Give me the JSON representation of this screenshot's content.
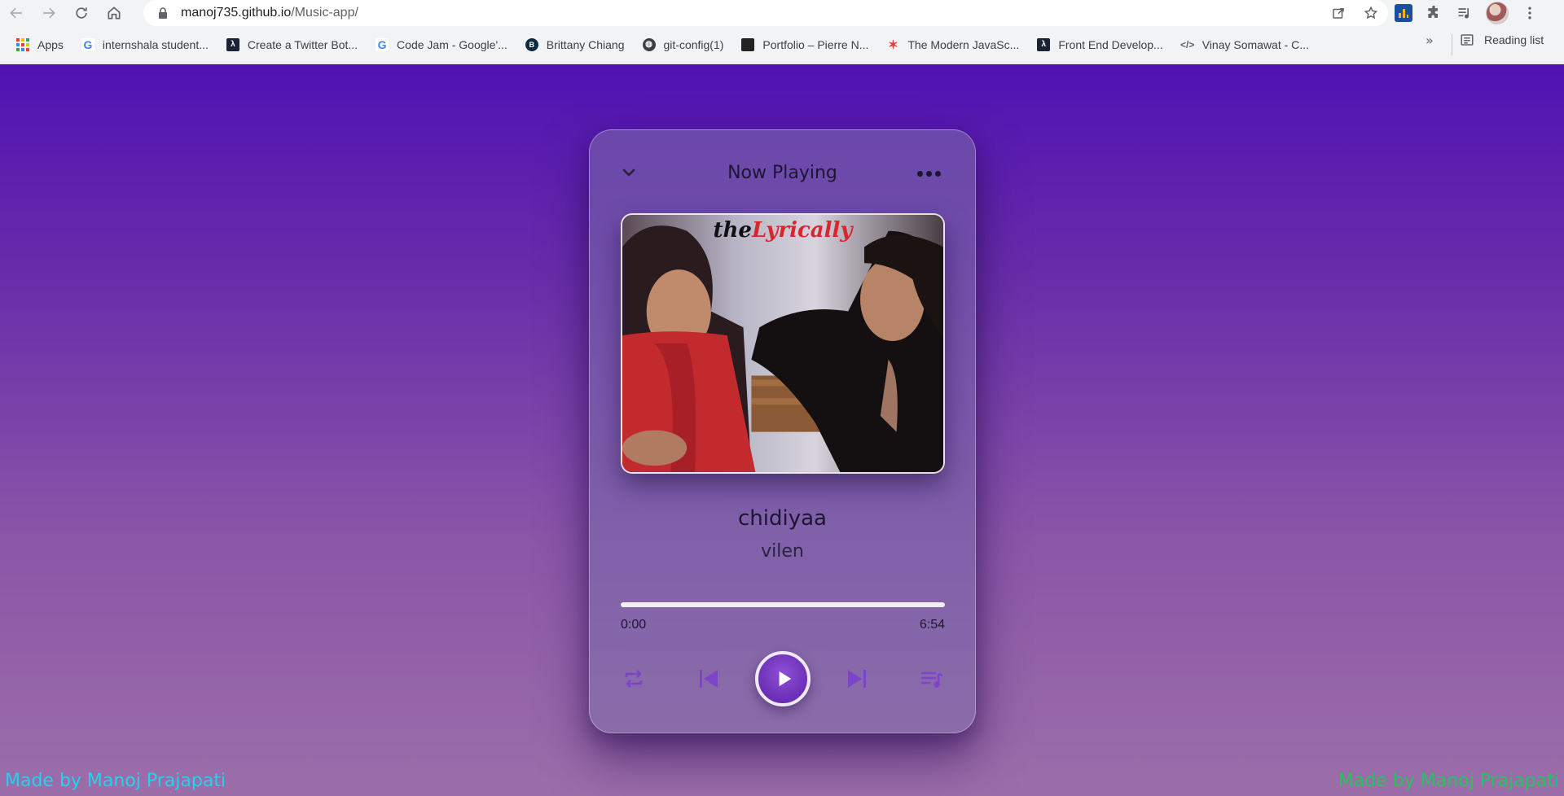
{
  "browser": {
    "url_host": "manoj735.github.io",
    "url_path": "/Music-app/",
    "bookmarks": [
      {
        "label": "Apps",
        "icon": "apps-grid-icon"
      },
      {
        "label": "internshala student...",
        "icon": "google-icon"
      },
      {
        "label": "Create a Twitter Bot...",
        "icon": "lambda-icon"
      },
      {
        "label": "Code Jam - Google'...",
        "icon": "google-icon"
      },
      {
        "label": "Brittany Chiang",
        "icon": "b-logo-icon"
      },
      {
        "label": "git-config(1)",
        "icon": "globe-icon"
      },
      {
        "label": "Portfolio – Pierre N...",
        "icon": "dark-square-icon"
      },
      {
        "label": "The Modern JavaSc...",
        "icon": "figure-icon"
      },
      {
        "label": "Front End Develop...",
        "icon": "lambda-icon"
      },
      {
        "label": "Vinay Somawat - C...",
        "icon": "code-icon"
      }
    ],
    "more": "»",
    "reading_list": "Reading list"
  },
  "player": {
    "header_title": "Now Playing",
    "cover_logo_part1": "the",
    "cover_logo_part2": "Lyrically",
    "song_title": "chidiyaa",
    "artist": "vilen",
    "current_time": "0:00",
    "total_time": "6:54",
    "progress_fraction": 0,
    "accent_color": "#7d44c8"
  },
  "footer": {
    "credit_left": "Made by Manoj Prajapati",
    "credit_right": "Made by Manoj Prajapati",
    "credit_left_color": "#22d3ee",
    "credit_right_color": "#22c55e"
  }
}
